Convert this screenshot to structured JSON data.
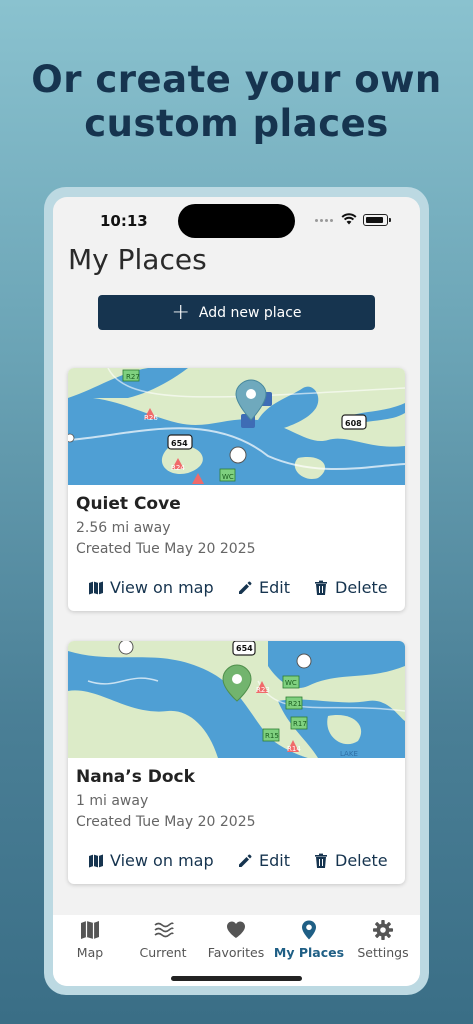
{
  "headline": {
    "line1": "Or create your own",
    "line2": "custom places"
  },
  "status_bar": {
    "time": "10:13"
  },
  "page": {
    "title": "My Places",
    "add_button_label": "Add new place"
  },
  "places": [
    {
      "name": "Quiet Cove",
      "distance": "2.56 mi away",
      "created": "Created Tue May 20 2025",
      "map_labels": [
        "R27",
        "R26",
        "654",
        "R24",
        "WC",
        "608"
      ],
      "actions": {
        "view": "View on map",
        "edit": "Edit",
        "delete": "Delete"
      }
    },
    {
      "name": "Nana’s Dock",
      "distance": "1 mi away",
      "created": "Created Tue May 20 2025",
      "map_labels": [
        "654",
        "R23",
        "WC",
        "R21",
        "R17",
        "R15",
        "R14",
        "LAKE"
      ],
      "actions": {
        "view": "View on map",
        "edit": "Edit",
        "delete": "Delete"
      }
    }
  ],
  "tabs": [
    {
      "label": "Map",
      "icon": "map-icon"
    },
    {
      "label": "Current",
      "icon": "waves-icon"
    },
    {
      "label": "Favorites",
      "icon": "heart-icon"
    },
    {
      "label": "My Places",
      "icon": "location-pin-icon",
      "active": true
    },
    {
      "label": "Settings",
      "icon": "gear-icon"
    }
  ],
  "colors": {
    "brand_navy": "#16344f",
    "active_tab": "#1f5f85",
    "water": "#4f9fd4",
    "land": "#dcebc8",
    "pin": "#6fa9bd"
  }
}
